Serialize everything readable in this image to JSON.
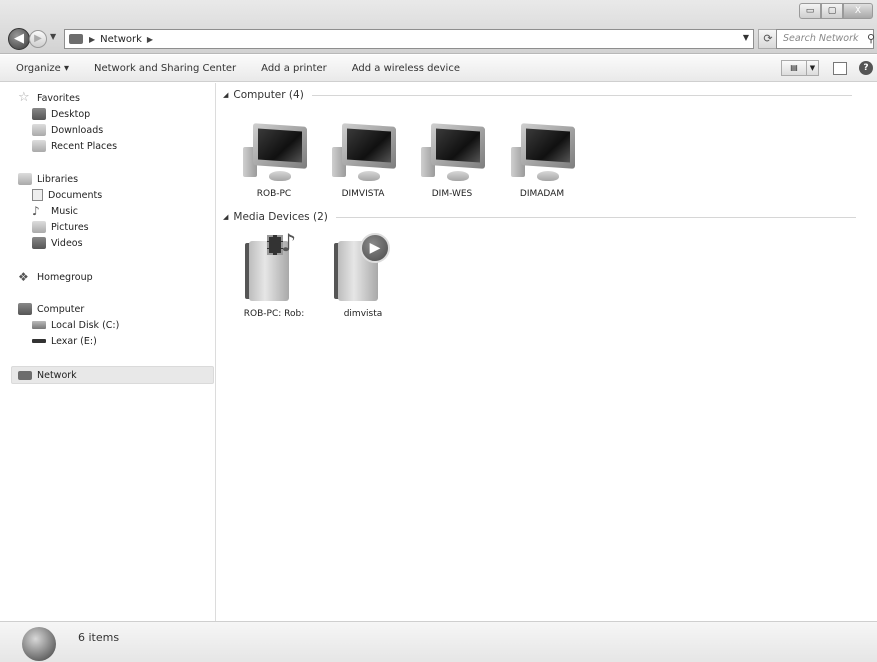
{
  "window": {
    "controls": {
      "minimize": "▭",
      "maximize": "▢",
      "close": "X"
    }
  },
  "address_bar": {
    "crumbs": [
      "Network"
    ],
    "search_placeholder": "Search Network"
  },
  "toolbar": {
    "items": [
      "Organize ▾",
      "Network and Sharing Center",
      "Add a printer",
      "Add a wireless device"
    ]
  },
  "sidebar": {
    "favorites": {
      "label": "Favorites",
      "icon": "star-icon"
    },
    "desktop": {
      "label": "Desktop",
      "icon": "desktop-icon"
    },
    "downloads": {
      "label": "Downloads",
      "icon": "downloads-icon"
    },
    "recent": {
      "label": "Recent Places",
      "icon": "recent-places-icon"
    },
    "libraries": {
      "label": "Libraries",
      "icon": "libraries-icon"
    },
    "documents": {
      "label": "Documents",
      "icon": "document-icon"
    },
    "music": {
      "label": "Music",
      "icon": "music-icon"
    },
    "pictures": {
      "label": "Pictures",
      "icon": "pictures-icon"
    },
    "videos": {
      "label": "Videos",
      "icon": "videos-icon"
    },
    "homegroup": {
      "label": "Homegroup",
      "icon": "homegroup-icon"
    },
    "computer": {
      "label": "Computer",
      "icon": "computer-icon"
    },
    "local_disk": {
      "label": "Local Disk (C:)",
      "icon": "disk-icon"
    },
    "lexar": {
      "label": "Lexar (E:)",
      "icon": "drive-icon"
    },
    "network": {
      "label": "Network",
      "icon": "network-icon",
      "selected": true
    }
  },
  "groups": {
    "computers": {
      "header": "Computer (4)",
      "items": [
        "ROB-PC",
        "DIMVISTA",
        "DIM-WES",
        "DIMADAM"
      ]
    },
    "media": {
      "header": "Media Devices (2)",
      "items": [
        "ROB-PC: Rob:",
        "dimvista"
      ]
    }
  },
  "status": {
    "count": "6 items"
  }
}
